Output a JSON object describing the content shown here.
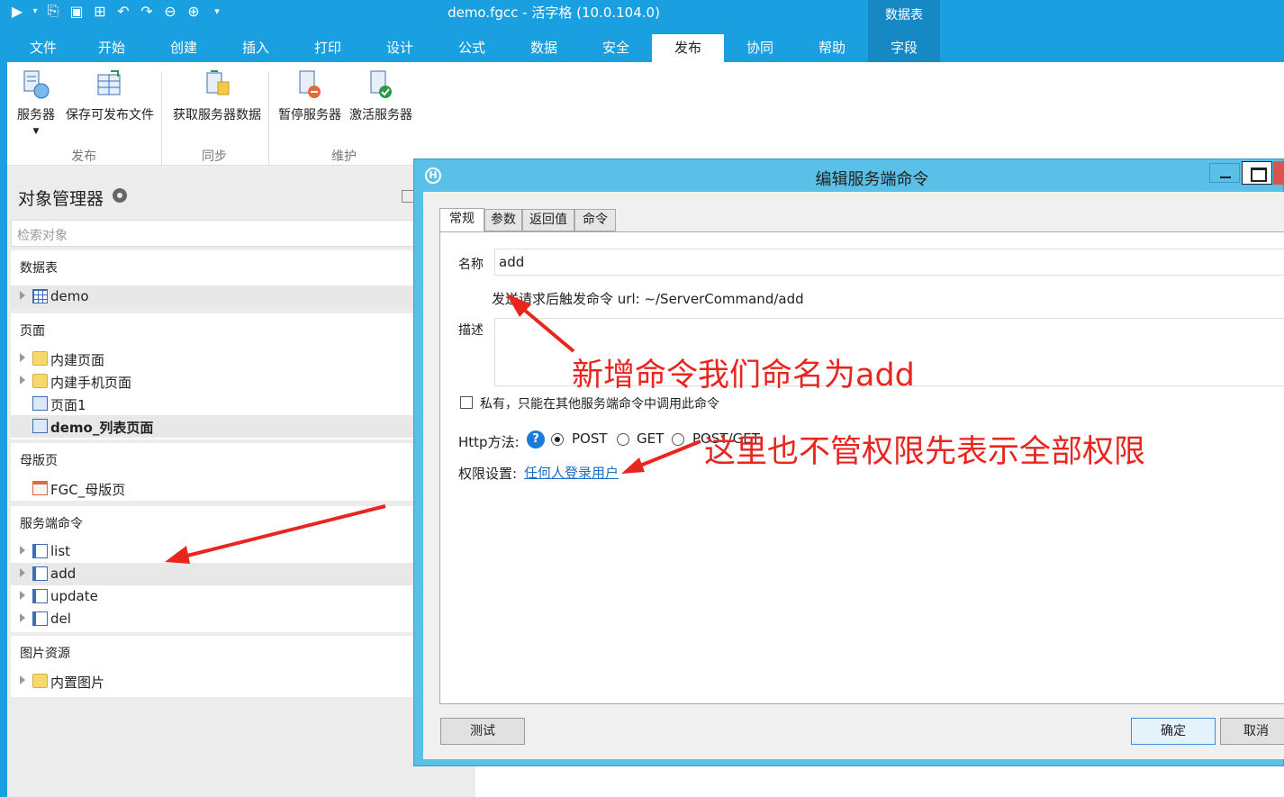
{
  "window": {
    "title": "demo.fgcc - 活字格 (10.0.104.0)",
    "context_group": "数据表"
  },
  "ribbon_tabs": [
    {
      "label": "文件"
    },
    {
      "label": "开始"
    },
    {
      "label": "创建"
    },
    {
      "label": "插入"
    },
    {
      "label": "打印"
    },
    {
      "label": "设计"
    },
    {
      "label": "公式"
    },
    {
      "label": "数据"
    },
    {
      "label": "安全"
    },
    {
      "label": "发布"
    },
    {
      "label": "协同"
    },
    {
      "label": "帮助"
    },
    {
      "label": "字段"
    }
  ],
  "ribbon": {
    "buttons": {
      "server": "服务器",
      "save_publish": "保存可发布文件",
      "fetch_data": "获取服务器数据",
      "pause_server": "暂停服务器",
      "activate_server": "激活服务器"
    },
    "groups": {
      "publish": "发布",
      "sync": "同步",
      "maintain": "维护"
    }
  },
  "object_manager": {
    "title": "对象管理器",
    "search_placeholder": "检索对象",
    "sections": {
      "tables": {
        "header": "数据表",
        "items": [
          "demo"
        ]
      },
      "pages": {
        "header": "页面",
        "items": [
          "内建页面",
          "内建手机页面",
          "页面1",
          "demo_列表页面"
        ]
      },
      "masters": {
        "header": "母版页",
        "items": [
          "FGC_母版页"
        ]
      },
      "commands": {
        "header": "服务端命令",
        "items": [
          "list",
          "add",
          "update",
          "del"
        ]
      },
      "images": {
        "header": "图片资源",
        "items": [
          "内置图片"
        ]
      }
    }
  },
  "dialog": {
    "title": "编辑服务端命令",
    "tabs": [
      "常规",
      "参数",
      "返回值",
      "命令"
    ],
    "name_label": "名称",
    "name_value": "add",
    "url_hint": "发送请求后触发命令 url: ~/ServerCommand/add",
    "desc_label": "描述",
    "private_label": "私有，只能在其他服务端命令中调用此命令",
    "http_label": "Http方法:",
    "http_options": [
      "POST",
      "GET",
      "POST/GET"
    ],
    "perm_label": "权限设置:",
    "perm_link": "任何人登录用户",
    "btn_test": "测试",
    "btn_ok": "确定",
    "btn_cancel": "取消"
  },
  "annotations": {
    "name_note": "新增命令我们命名为add",
    "perm_note": "这里也不管权限先表示全部权限"
  },
  "colors": {
    "accent": "#1aa0e0",
    "dialog_frame": "#5bc0e8",
    "annotation": "#e8261f",
    "link": "#1a6ec8"
  }
}
